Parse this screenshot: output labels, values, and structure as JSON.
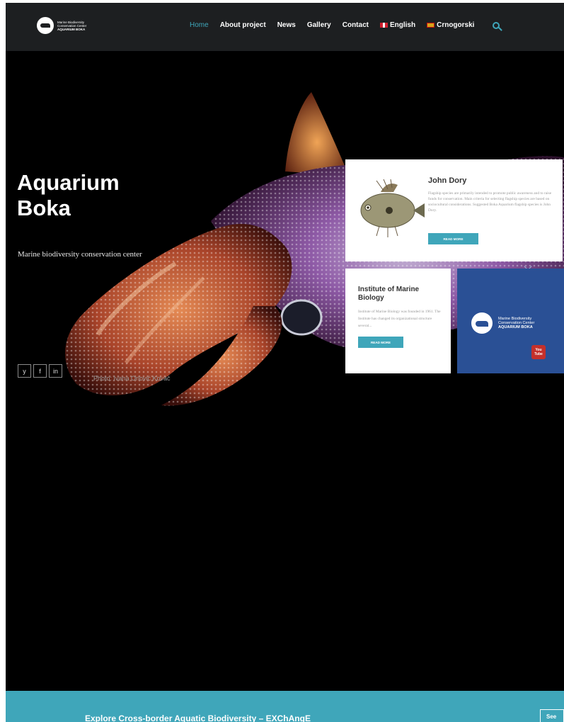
{
  "header": {
    "logo": {
      "line1": "Marine Biodiversity",
      "line2": "Conservation Center",
      "line3": "AQUARIUM BOKA"
    },
    "nav": [
      {
        "label": "Home",
        "active": true
      },
      {
        "label": "About project"
      },
      {
        "label": "News"
      },
      {
        "label": "Gallery"
      },
      {
        "label": "Contact"
      }
    ],
    "languages": [
      {
        "label": "English",
        "flag": "uk-flag-icon"
      },
      {
        "label": "Crnogorski",
        "flag": "montenegro-flag-icon"
      }
    ],
    "search_icon": "search-icon"
  },
  "hero": {
    "title_line1": "Aquarium",
    "title_line2": "Boka",
    "subtitle": "Marine biodiversity conservation center",
    "social": [
      "y",
      "f",
      "in"
    ],
    "photo_credit": "Photo: Ivana Orlović Kovač"
  },
  "cards": {
    "john_dory": {
      "title": "John Dory",
      "text": "Flagship species are primarily intended to promote public awareness and to raise funds for conservation. Main criteria for selecting flagship species are based on sociocultural considerations. Suggested Boka Aquarium flagship species is John Dory.",
      "button": "READ MORE"
    },
    "institute": {
      "title": "Institute of Marine Biology",
      "text": "Institute of Marine Biology was founded in 1961. The Institute has changed its organizational structure several...",
      "button": "READ MORE"
    },
    "promo": {
      "line1": "Marine Biodiversity",
      "line2": "Conservation Center",
      "line3": "AQUARIUM BOKA",
      "yt_top": "You",
      "yt_bottom": "Tube"
    }
  },
  "bottom_bar": {
    "text": "Explore Cross-border Aquatic Biodiversity – EXChAngE",
    "button": "See"
  },
  "colors": {
    "accent": "#3fa6ba",
    "header_bg": "#1d1f21",
    "promo_bg": "#2a5095"
  }
}
